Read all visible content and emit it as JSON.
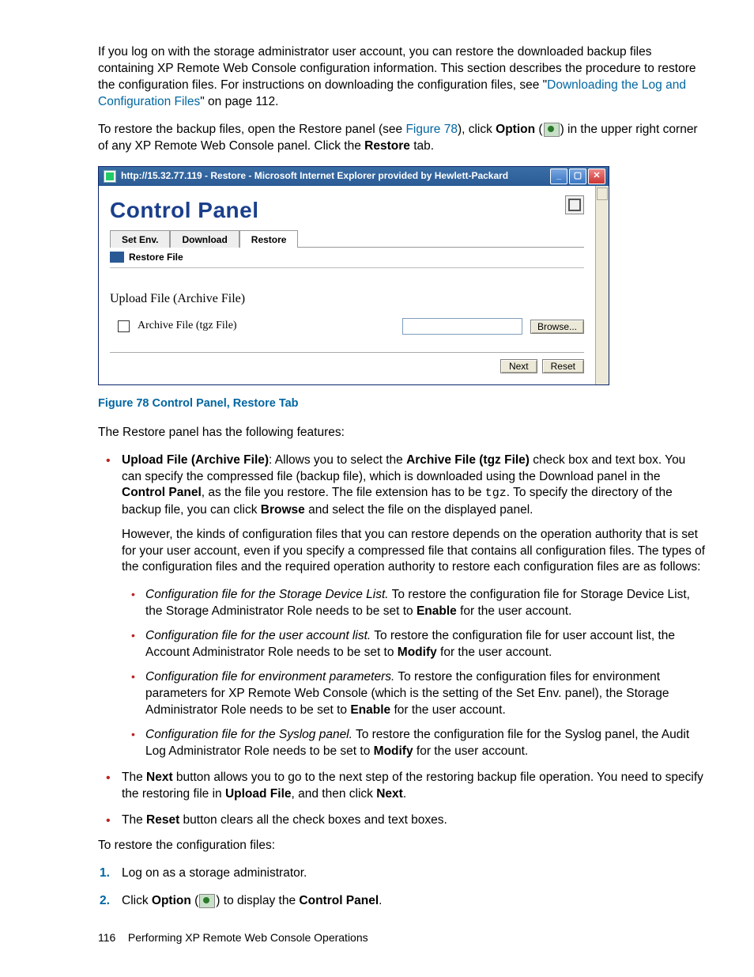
{
  "intro": {
    "p1": "If you log on with the storage administrator user account, you can restore the downloaded backup files containing XP Remote Web Console configuration information. This section describes the procedure to restore the configuration files. For instructions on downloading the configuration files, see \"",
    "p1_link": "Downloading the Log and Configuration Files",
    "p1_tail": "\" on page 112.",
    "p2_a": "To restore the backup files, open the Restore panel (see ",
    "p2_link": "Figure 78",
    "p2_b": "), click ",
    "p2_bold1": "Option",
    "p2_c": " (",
    "p2_d": ") in the upper right corner of any XP Remote Web Console panel. Click the ",
    "p2_bold2": "Restore",
    "p2_e": " tab."
  },
  "screenshot": {
    "title": "http://15.32.77.119 - Restore - Microsoft Internet Explorer provided by Hewlett-Packard",
    "cp_title": "Control Panel",
    "tabs": {
      "setenv": "Set Env.",
      "download": "Download",
      "restore": "Restore"
    },
    "subtab": "Restore File",
    "section_title": "Upload File (Archive File)",
    "check_label": "Archive File (tgz File)",
    "browse": "Browse...",
    "next": "Next",
    "reset": "Reset"
  },
  "caption": "Figure 78 Control Panel, Restore Tab",
  "features_intro": "The Restore panel has the following features:",
  "feat1": {
    "lead_b": "Upload File (Archive File)",
    "lead_t": ": Allows you to select the ",
    "mid_b": "Archive File (tgz File)",
    "mid_t": " check box and text box. You can specify the compressed file (backup file), which is downloaded using the Download panel in the ",
    "cp_b": "Control Panel",
    "t2": ", as the file you restore. The file extension has to be ",
    "mono": "tgz",
    "t3": ". To specify the directory of the backup file, you can click ",
    "browse_b": "Browse",
    "t4": " and select the file on the displayed panel.",
    "p2": "However, the kinds of configuration files that you can restore depends on the operation authority that is set for your user account, even if you specify a compressed file that contains all configuration files. The types of the configuration files and the required operation authority to restore each configuration files are as follows:"
  },
  "sub": {
    "s1_i": "Configuration file for the Storage Device List.",
    "s1_t": " To restore the configuration file for Storage Device List, the Storage Administrator Role needs to be set to ",
    "s1_b": "Enable",
    "s1_e": " for the user account.",
    "s2_i": "Configuration file for the user account list.",
    "s2_t": " To restore the configuration file for user account list, the Account Administrator Role needs to be set to ",
    "s2_b": "Modify",
    "s2_e": " for the user account.",
    "s3_i": "Configuration file for environment parameters.",
    "s3_t": " To restore the configuration files for environment parameters for XP Remote Web Console (which is the setting of the Set Env. panel), the Storage Administrator Role needs to be set to ",
    "s3_b": "Enable",
    "s3_e": " for the user account.",
    "s4_i": "Configuration file for the Syslog panel.",
    "s4_t": " To restore the configuration file for the Syslog panel, the Audit Log Administrator Role needs to be set to ",
    "s4_b": "Modify",
    "s4_e": " for the user account."
  },
  "feat2": {
    "a": "The ",
    "b1": "Next",
    "b": " button allows you to go to the next step of the restoring backup file operation. You need to specify the restoring file in ",
    "b2": "Upload File",
    "c": ", and then click ",
    "b3": "Next",
    "d": "."
  },
  "feat3": {
    "a": "The ",
    "b": "Reset",
    "c": " button clears all the check boxes and text boxes."
  },
  "steps_intro": "To restore the configuration files:",
  "step1": "Log on as a storage administrator.",
  "step2": {
    "a": "Click ",
    "b1": "Option",
    "b": " (",
    "c": ") to display the ",
    "b2": "Control Panel",
    "d": "."
  },
  "footer": {
    "page": "116",
    "chapter": "Performing XP Remote Web Console Operations"
  }
}
